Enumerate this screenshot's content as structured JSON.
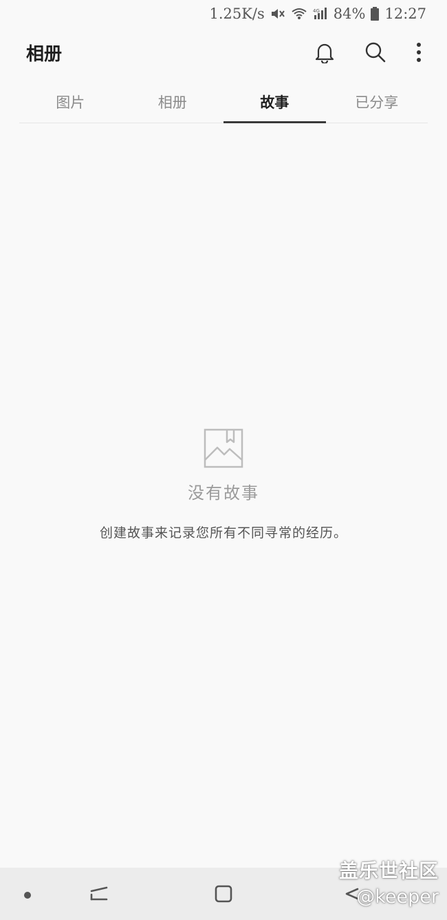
{
  "status_bar": {
    "net_speed": "1.25K/s",
    "battery": "84%",
    "time": "12:27"
  },
  "app_bar": {
    "title": "相册"
  },
  "tabs": [
    {
      "label": "图片",
      "active": false
    },
    {
      "label": "相册",
      "active": false
    },
    {
      "label": "故事",
      "active": true
    },
    {
      "label": "已分享",
      "active": false
    }
  ],
  "empty_state": {
    "title": "没有故事",
    "description": "创建故事来记录您所有不同寻常的经历。"
  },
  "watermark": {
    "line1": "盖乐世社区",
    "line2": "@keeper"
  },
  "icons": {
    "notifications": "bell-icon",
    "search": "search-icon",
    "more": "more-vert-icon"
  }
}
